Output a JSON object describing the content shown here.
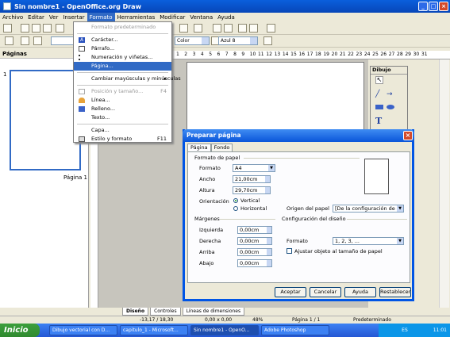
{
  "window": {
    "title": "Sin nombre1 - OpenOffice.org Draw"
  },
  "menubar": [
    "Archivo",
    "Editar",
    "Ver",
    "Insertar",
    "Formato",
    "Herramientas",
    "Modificar",
    "Ventana",
    "Ayuda"
  ],
  "toolbar2": {
    "color_combo": "Color",
    "line_color_combo": "Azul 8"
  },
  "pages_panel": {
    "title": "Páginas",
    "page_number": "1",
    "page_label": "Página 1"
  },
  "ruler_numbers": [
    "1",
    "2",
    "3",
    "4",
    "5",
    "6",
    "7",
    "8",
    "9",
    "10",
    "11",
    "12",
    "13",
    "14",
    "15",
    "16",
    "17",
    "18",
    "19",
    "20",
    "21",
    "22",
    "23",
    "24",
    "25",
    "26",
    "27",
    "28",
    "29",
    "30",
    "31"
  ],
  "drawing_toolbar": {
    "title": "Dibujo"
  },
  "format_menu": {
    "items": [
      {
        "label": "Formato predeterminado",
        "disabled": true
      },
      {
        "label": "Carácter..."
      },
      {
        "label": "Párrafo..."
      },
      {
        "label": "Numeración y viñetas..."
      },
      {
        "label": "Página...",
        "selected": true
      },
      {
        "label": "Cambiar mayúsculas y minúsculas",
        "submenu": true
      },
      {
        "label": "Posición y tamaño...",
        "shortcut": "F4",
        "disabled": true
      },
      {
        "label": "Línea..."
      },
      {
        "label": "Relleno..."
      },
      {
        "label": "Texto..."
      },
      {
        "label": "Capa..."
      },
      {
        "label": "Estilo y formato",
        "shortcut": "F11"
      }
    ]
  },
  "dialog": {
    "title": "Preparar página",
    "tabs": [
      "Página",
      "Fondo"
    ],
    "paper_format_heading": "Formato de papel",
    "format_label": "Formato",
    "format_value": "A4",
    "width_label": "Ancho",
    "width_value": "21,00cm",
    "height_label": "Altura",
    "height_value": "29,70cm",
    "orientation_label": "Orientación",
    "orientation_vertical": "Vertical",
    "orientation_horizontal": "Horizontal",
    "paper_source_label": "Origen del papel",
    "paper_source_value": "[De la configuración de impre",
    "margins_heading": "Márgenes",
    "left_label": "Izquierda",
    "left_value": "0,00cm",
    "right_label": "Derecha",
    "right_value": "0,00cm",
    "top_label": "Arriba",
    "top_value": "0,00cm",
    "bottom_label": "Abajo",
    "bottom_value": "0,00cm",
    "layout_heading": "Configuración del diseño",
    "layout_format_label": "Formato",
    "layout_format_value": "1, 2, 3, ...",
    "fit_checkbox": "Ajustar objeto al tamaño de papel",
    "buttons": {
      "ok": "Aceptar",
      "cancel": "Cancelar",
      "help": "Ayuda",
      "reset": "Restablecer"
    }
  },
  "view_tabs": [
    "Diseño",
    "Controles",
    "Líneas de dimensiones"
  ],
  "statusbar": {
    "position": "-13,17 / 18,30",
    "size": "0,00 x 0,00",
    "zoom": "48%",
    "page": "Página 1 / 1",
    "style": "Predeterminado"
  },
  "taskbar": {
    "start": "Inicio",
    "tasks": [
      "Dibujo vectorial con D...",
      "capitulo_1 - Microsoft...",
      "Sin nombre1 - OpenO...",
      "Adobe Photoshop"
    ],
    "lang": "ES",
    "clock": "11:01"
  }
}
